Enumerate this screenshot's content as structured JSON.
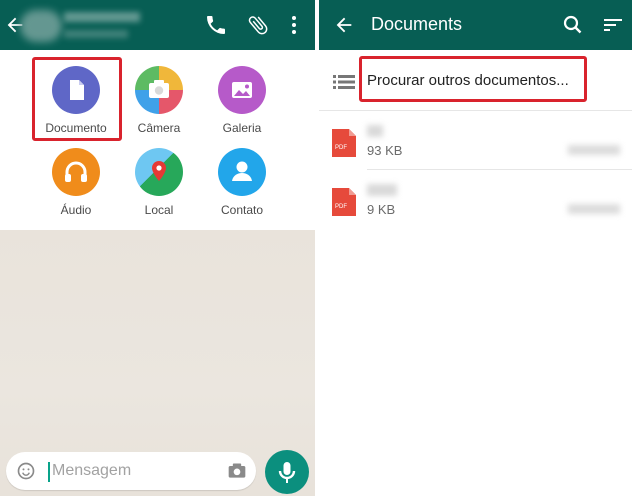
{
  "left_panel": {
    "attachments": [
      {
        "label": "Documento",
        "color": "#5f67c7",
        "icon": "document-icon"
      },
      {
        "label": "Câmera",
        "color": "#e5576a",
        "icon": "camera-icon"
      },
      {
        "label": "Galeria",
        "color": "#b65ac9",
        "icon": "gallery-icon"
      },
      {
        "label": "Áudio",
        "color": "#f08c1b",
        "icon": "headphones-icon"
      },
      {
        "label": "Local",
        "color": "#27a85a",
        "icon": "location-icon"
      },
      {
        "label": "Contato",
        "color": "#22a6ea",
        "icon": "contact-icon"
      }
    ],
    "message_placeholder": "Mensagem"
  },
  "right_panel": {
    "title": "Documents",
    "browse_label": "Procurar outros documentos...",
    "files": [
      {
        "size": "93 KB",
        "type": "PDF"
      },
      {
        "size": "9 KB",
        "type": "PDF"
      }
    ]
  },
  "colors": {
    "header": "#075e54",
    "highlight": "#d9232d",
    "mic_button": "#0b8f7e",
    "pdf_red": "#e64a3b"
  }
}
